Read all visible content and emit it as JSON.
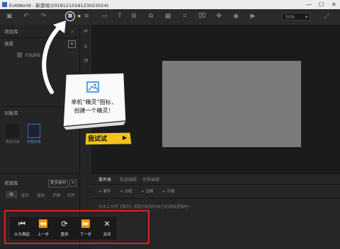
{
  "window": {
    "title": "EvKWorld - 新游戏(2019121016123023024)"
  },
  "toolbar": {
    "zoom": "50%"
  },
  "left_panel": {
    "project_header": "项目库",
    "scenes_label": "场景",
    "scene_item": "开始游戏",
    "objects_header": "对象库",
    "objects": [
      "角色对象",
      "可视对象"
    ],
    "resources_header": "资源库",
    "more_button": "更多素材",
    "resource_tabs": [
      "音乐",
      "音效",
      "字体",
      "文件"
    ]
  },
  "events": {
    "tabs": [
      "事件表",
      "数据编辑",
      "场景编辑"
    ],
    "buttons": [
      "事件",
      "分组",
      "注释",
      "引用"
    ],
    "hint": "点击上方的【事件】按钮开始制作自己的游戏逻辑吧~"
  },
  "tip": {
    "line1": "单机“精灵”图标，",
    "line2": "创建一个精灵！",
    "try_button": "我试试"
  },
  "tutorial": {
    "buttons": [
      {
        "label": "从头做起",
        "icon": "restart-icon"
      },
      {
        "label": "上一步",
        "icon": "previous-icon"
      },
      {
        "label": "重放",
        "icon": "replay-icon"
      },
      {
        "label": "下一步",
        "icon": "next-icon"
      },
      {
        "label": "关闭",
        "icon": "close-icon"
      }
    ]
  },
  "colors": {
    "highlight": "#e02020",
    "stage": "#7b7b7b",
    "try_button": "#f4c21a"
  }
}
